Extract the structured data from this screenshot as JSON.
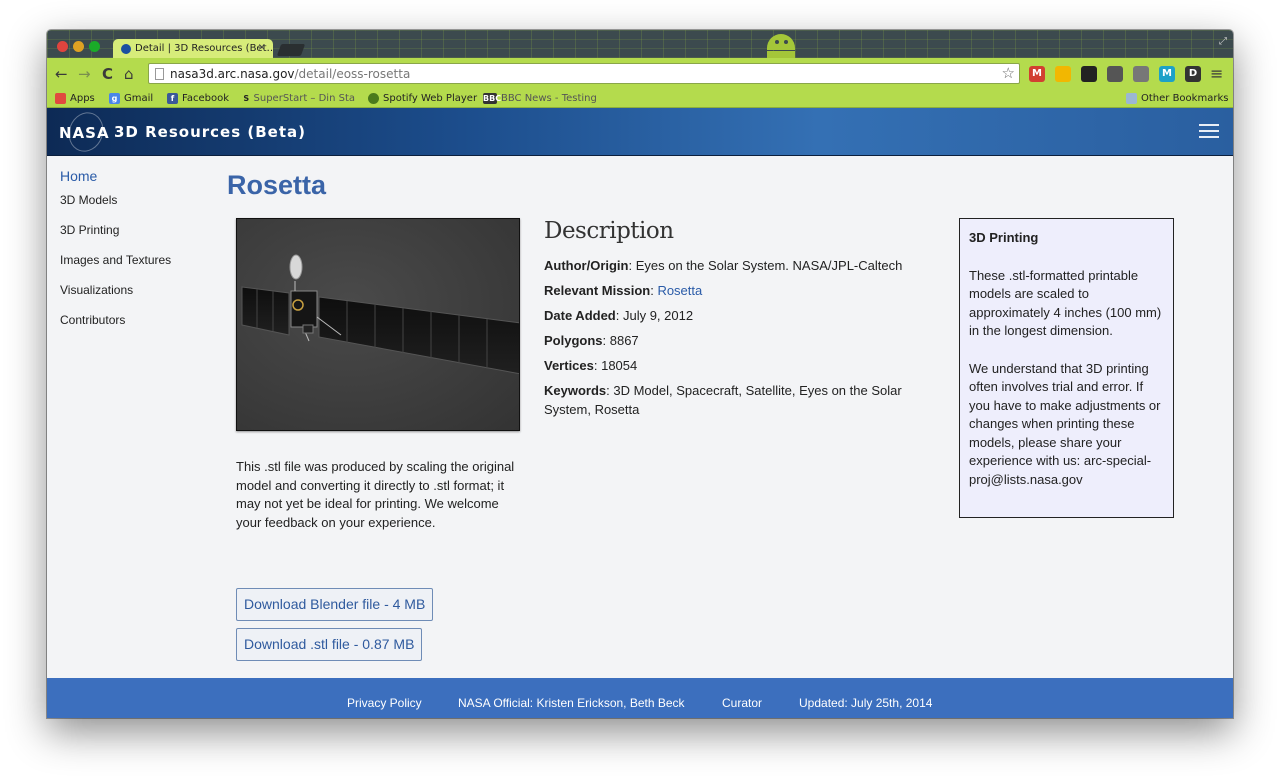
{
  "browser": {
    "tab_title": "Detail | 3D Resources (Bet…",
    "tab_close": "×",
    "url_domain": "nasa3d.arc.nasa.gov",
    "url_path": "/detail/eoss-rosetta",
    "nav": {
      "back": "←",
      "forward": "→",
      "reload": "C",
      "home": "⌂"
    },
    "star": "☆",
    "extensions": [
      {
        "name": "gmail-checker-icon",
        "color": "#d23f31",
        "label": "M"
      },
      {
        "name": "google-drive-icon",
        "color": "#f2b701",
        "label": ""
      },
      {
        "name": "owl-extension-icon",
        "color": "#222222",
        "label": ""
      },
      {
        "name": "tools-extension-icon",
        "color": "#555555",
        "label": ""
      },
      {
        "name": "cast-icon",
        "color": "#777777",
        "label": ""
      },
      {
        "name": "marker-extension-icon",
        "color": "#1da1c8",
        "label": "M"
      },
      {
        "name": "d-extension-icon",
        "color": "#333333",
        "label": "D"
      }
    ],
    "menu_icon": "≡",
    "bookmarks": [
      {
        "label": "Apps",
        "icon_color": "#e04a3f"
      },
      {
        "label": "Gmail",
        "icon_color": "#4a86e8"
      },
      {
        "label": "Facebook",
        "icon_color": "#3b5998"
      },
      {
        "label": "SuperStart – Din Sta",
        "icon_color": "#222222"
      },
      {
        "label": "Spotify Web Player",
        "icon_color": "#4a7a1c"
      },
      {
        "label": "BBC News - Testing",
        "icon_color": "#333333"
      }
    ],
    "other_bookmarks": "Other Bookmarks"
  },
  "header": {
    "logo_word": "NASA",
    "site_title": "3D Resources (Beta)"
  },
  "sidebar": {
    "home": "Home",
    "items": [
      "3D Models",
      "3D Printing",
      "Images and Textures",
      "Visualizations",
      "Contributors"
    ]
  },
  "page": {
    "title": "Rosetta",
    "stl_note": "This .stl file was produced by scaling the original model and converting it directly to .stl format; it may not yet be ideal for printing. We welcome your feedback on your experience.",
    "download_blender": "Download Blender file - 4 MB",
    "download_stl": "Download .stl file - 0.87 MB"
  },
  "description": {
    "heading": "Description",
    "author_label": "Author/Origin",
    "author_value": ": Eyes on the Solar System. NASA/JPL-Caltech",
    "mission_label": "Relevant Mission",
    "mission_sep": ": ",
    "mission_value": "Rosetta",
    "date_label": "Date Added",
    "date_value": ": July 9, 2012",
    "polygons_label": "Polygons",
    "polygons_value": ": 8867",
    "vertices_label": "Vertices",
    "vertices_value": ": 18054",
    "keywords_label": "Keywords",
    "keywords_value": ": 3D Model, Spacecraft, Satellite, Eyes on the Solar System, Rosetta"
  },
  "printing": {
    "heading": "3D Printing",
    "para1": "These .stl-formatted printable models are scaled to approximately 4 inches (100 mm) in the longest dimension.",
    "para2": "We understand that 3D printing often involves trial and error. If you have to make adjustments or changes when printing these models, please share your experience with us: arc-special-proj@lists.nasa.gov"
  },
  "footer": {
    "privacy": "Privacy Policy",
    "official": "NASA Official: Kristen Erickson, Beth Beck",
    "curator": "Curator",
    "updated": "Updated: July 25th, 2014"
  }
}
